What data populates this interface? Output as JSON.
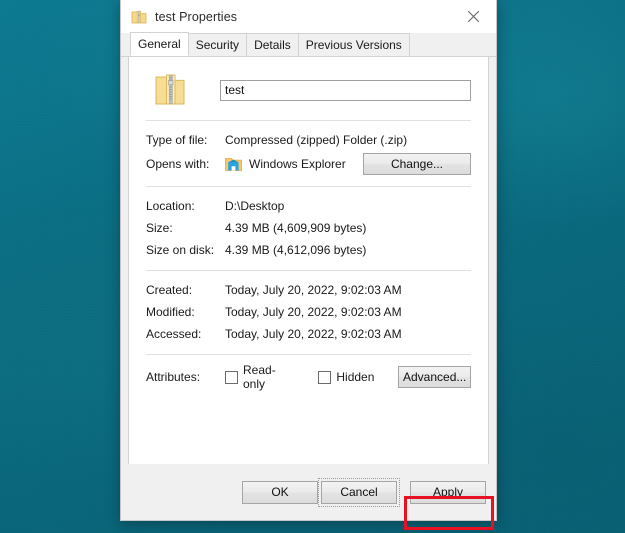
{
  "desktop": {
    "background_color": "#0b7287"
  },
  "dialog": {
    "title": "test Properties",
    "title_icon": "zip-folder-icon",
    "close_icon": "close-icon",
    "tabs": [
      {
        "label": "General",
        "active": true
      },
      {
        "label": "Security",
        "active": false
      },
      {
        "label": "Details",
        "active": false
      },
      {
        "label": "Previous Versions",
        "active": false
      }
    ],
    "general": {
      "file_icon": "zip-folder-icon",
      "name_value": "test",
      "name_placeholder": "",
      "rows": [
        {
          "label": "Type of file:",
          "value": "Compressed (zipped) Folder (.zip)"
        }
      ],
      "opens_with": {
        "label": "Opens with:",
        "app_icon": "windows-explorer-icon",
        "app_name": "Windows Explorer",
        "change_button": "Change..."
      },
      "location_rows": [
        {
          "label": "Location:",
          "value": "D:\\Desktop"
        },
        {
          "label": "Size:",
          "value": "4.39 MB (4,609,909 bytes)"
        },
        {
          "label": "Size on disk:",
          "value": "4.39 MB (4,612,096 bytes)"
        }
      ],
      "date_rows": [
        {
          "label": "Created:",
          "value": "Today, July 20, 2022, 9:02:03 AM"
        },
        {
          "label": "Modified:",
          "value": "Today, July 20, 2022, 9:02:03 AM"
        },
        {
          "label": "Accessed:",
          "value": "Today, July 20, 2022, 9:02:03 AM"
        }
      ],
      "attributes": {
        "label": "Attributes:",
        "readonly_label": "Read-only",
        "readonly_checked": false,
        "hidden_label": "Hidden",
        "hidden_checked": false,
        "advanced_button": "Advanced..."
      }
    },
    "footer": {
      "ok_label": "OK",
      "cancel_label": "Cancel",
      "apply_label": "Apply"
    }
  },
  "annotation": {
    "highlight_color": "#e81123",
    "target": "apply-button"
  }
}
